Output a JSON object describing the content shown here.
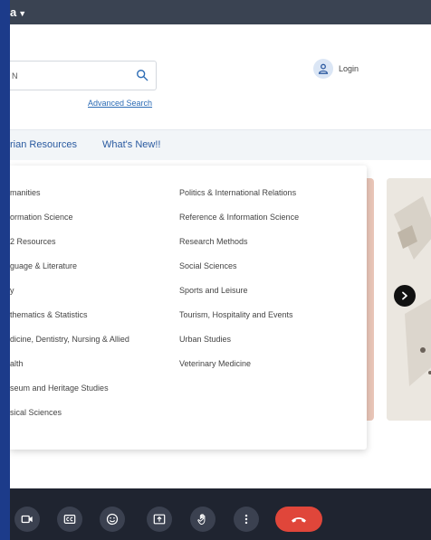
{
  "topbar": {
    "title": "a"
  },
  "search": {
    "value": "N"
  },
  "links": {
    "advanced_search": "Advanced Search",
    "login": "Login"
  },
  "nav": [
    {
      "label": "rian Resources"
    },
    {
      "label": "What's New!!"
    }
  ],
  "dropdown": {
    "left": [
      "manities",
      "ormation Science",
      "2 Resources",
      "guage & Literature",
      "y",
      "thematics & Statistics",
      "dicine, Dentistry, Nursing & Allied",
      "alth",
      "seum and Heritage Studies",
      "sical Sciences"
    ],
    "right": [
      "Politics & International Relations",
      "Reference & Information Science",
      "Research Methods",
      "Social Sciences",
      "Sports and Leisure",
      "Tourism, Hospitality and Events",
      "Urban Studies",
      "Veterinary Medicine"
    ]
  },
  "call_controls": [
    "camera-icon",
    "captions-icon",
    "emoji-icon",
    "present-icon",
    "raise-hand-icon",
    "more-icon",
    "end-call-icon"
  ],
  "colors": {
    "accent_link": "#2d6cb5",
    "end_call": "#e0463a",
    "left_strip": "#1c3b8a"
  }
}
